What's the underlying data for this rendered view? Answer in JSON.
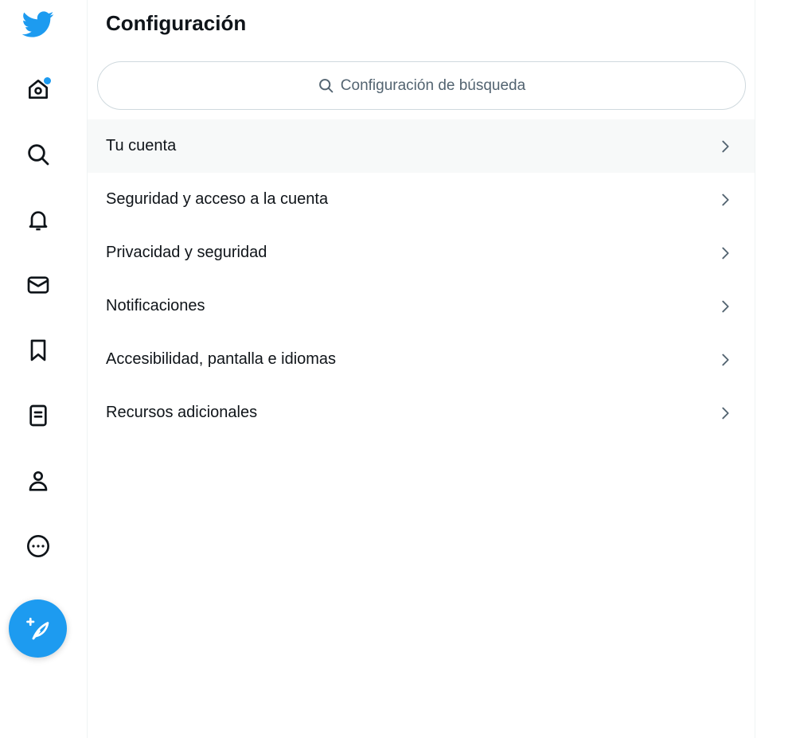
{
  "page": {
    "title": "Configuración"
  },
  "search": {
    "placeholder": "Configuración de búsqueda"
  },
  "nav": {
    "items": [
      {
        "icon": "twitter-bird-icon"
      },
      {
        "icon": "home-icon"
      },
      {
        "icon": "search-icon"
      },
      {
        "icon": "notifications-bell-icon"
      },
      {
        "icon": "messages-envelope-icon"
      },
      {
        "icon": "bookmark-icon"
      },
      {
        "icon": "lists-icon"
      },
      {
        "icon": "profile-icon"
      },
      {
        "icon": "more-options-icon"
      }
    ],
    "compose_icon": "compose-feather-plus-icon"
  },
  "settings_menu": {
    "items": [
      {
        "label": "Tu cuenta",
        "active": true
      },
      {
        "label": "Seguridad y acceso a la cuenta",
        "active": false
      },
      {
        "label": "Privacidad y seguridad",
        "active": false
      },
      {
        "label": "Notificaciones",
        "active": false
      },
      {
        "label": "Accesibilidad, pantalla e idiomas",
        "active": false
      },
      {
        "label": "Recursos adicionales",
        "active": false
      }
    ]
  },
  "colors": {
    "brand": "#1d9bf0",
    "text": "#0f1419",
    "muted": "#536471",
    "border": "#cfd9de",
    "active_row": "#f7f9f9"
  }
}
